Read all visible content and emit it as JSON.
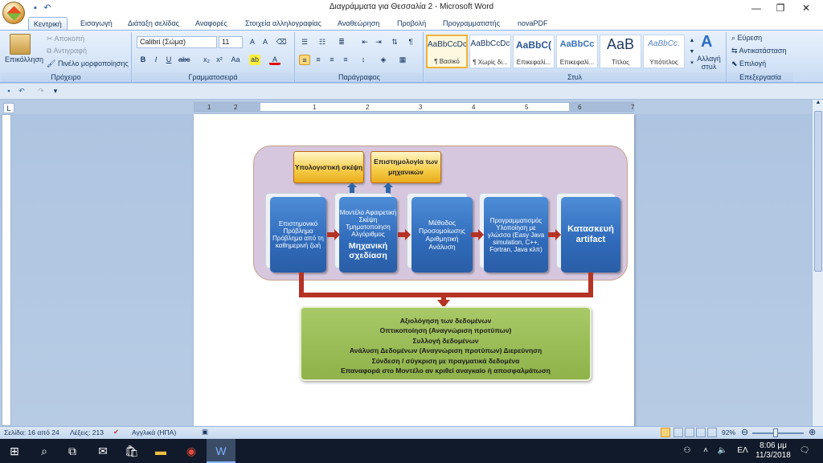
{
  "window": {
    "title": "Διαγράμματα για Θεσσαλία 2 - Microsoft Word"
  },
  "tabs": [
    "Κεντρική",
    "Εισαγωγή",
    "Διάταξη σελίδας",
    "Αναφορές",
    "Στοιχεία αλληλογραφίας",
    "Αναθεώρηση",
    "Προβολή",
    "Προγραμματιστής",
    "novaPDF"
  ],
  "clipboard": {
    "paste": "Επικόλληση",
    "cut": "Αποκοπή",
    "copy": "Αντιγραφή",
    "painter": "Πινέλο μορφοποίησης",
    "label": "Πρόχειρο"
  },
  "font": {
    "name": "Calibri (Σώμα)",
    "size": "11",
    "label": "Γραμματοσειρά"
  },
  "paragraph": {
    "label": "Παράγραφος"
  },
  "styles": {
    "label": "Στυλ",
    "items": [
      {
        "preview": "AaBbCcDc",
        "name": "¶ Βασικό"
      },
      {
        "preview": "AaBbCcDc",
        "name": "¶ Χωρίς δι..."
      },
      {
        "preview": "AaBbC(",
        "name": "Επικεφαλί..."
      },
      {
        "preview": "AaBbCc",
        "name": "Επικεφαλί..."
      },
      {
        "preview": "AaB",
        "name": "Τίτλος"
      },
      {
        "preview": "AaBbCc.",
        "name": "Υπότιτλος"
      }
    ],
    "change_label": "Αλλαγή στυλ"
  },
  "editing": {
    "find": "Εύρεση",
    "replace": "Αντικατάσταση",
    "select": "Επιλογή",
    "label": "Επεξεργασία"
  },
  "ruler": {
    "numbers": [
      "1",
      "2",
      "1",
      "2",
      "3",
      "4",
      "5",
      "6",
      "7"
    ]
  },
  "diagram": {
    "top_boxes": [
      "Υπολογιστική σκέψη",
      "Επιστημολογία των μηχανικών"
    ],
    "steps": [
      {
        "text": "Επιστημονικό Πρόβλημα Πρόβλημα από τη καθημερινή ζωή",
        "extra": ""
      },
      {
        "text": "Μοντέλο Αφαιρετική Σκέψη Τμηματοποίηση Αλγόριθμος",
        "extra": "Μηχανική σχεδίαση"
      },
      {
        "text": "Μέθοδος Προσομοίωσης Αριθμητική Ανάλυση",
        "extra": ""
      },
      {
        "text": "Προγραμματισμός Υλοποίηση με γλώσσα (Easy Java simulation, C++, Fortran, Java κλπ)",
        "extra": ""
      },
      {
        "text": "Κατασκευή artifact",
        "extra": ""
      }
    ],
    "bottom_lines": [
      "Αξιολόγηση των δεδομένων",
      "Οπτικοποίηση (Αναγνώριση προτύπων)",
      "Συλλογή δεδομένων",
      "Ανάλυση Δεδομένων (Αναγνώριση προτύπων) Διερεύνηση",
      "Σύνδεση / σύγκριση με πραγματικά δεδομένα",
      "Επαναφορά στο Μοντέλο αν κριθεί αναγκαίο ή αποσφαλμάτωση"
    ]
  },
  "status": {
    "page": "Σελίδα: 16 από 24",
    "words": "Λέξεις: 213",
    "language": "Αγγλικά (ΗΠΑ)",
    "zoom": "92%"
  },
  "taskbar": {
    "lang": "ΕΛ",
    "time": "8:06 μμ",
    "date": "11/3/2018"
  }
}
